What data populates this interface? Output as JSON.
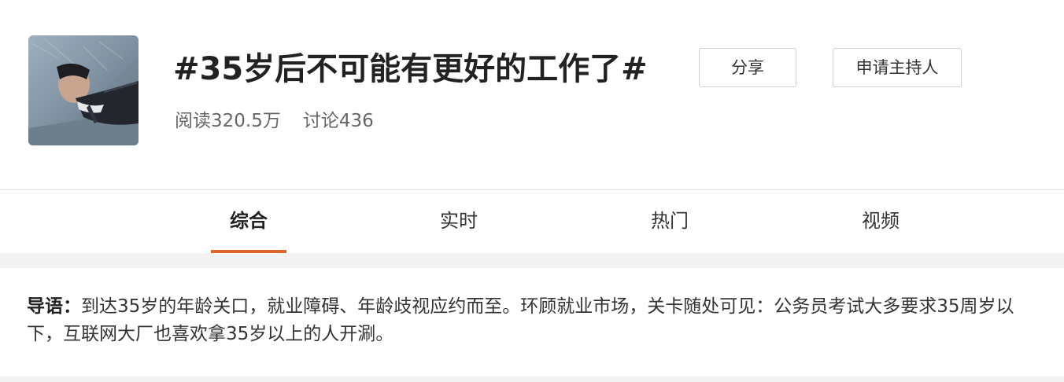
{
  "topic": {
    "title": "#35岁后不可能有更好的工作了#",
    "stats": {
      "reads": "阅读320.5万",
      "discussions": "讨论436"
    },
    "buttons": {
      "share": "分享",
      "apply_host": "申请主持人"
    }
  },
  "tabs": [
    {
      "label": "综合",
      "active": true
    },
    {
      "label": "实时",
      "active": false
    },
    {
      "label": "热门",
      "active": false
    },
    {
      "label": "视频",
      "active": false
    }
  ],
  "intro": {
    "label": "导语：",
    "text": "到达35岁的年龄关口，就业障碍、年龄歧视应约而至。环顾就业市场，关卡随处可见：公务员考试大多要求35周岁以下，互联网大厂也喜欢拿35岁以上的人开涮。"
  },
  "colors": {
    "accent": "#e0662b",
    "background": "#f3f3f3"
  }
}
